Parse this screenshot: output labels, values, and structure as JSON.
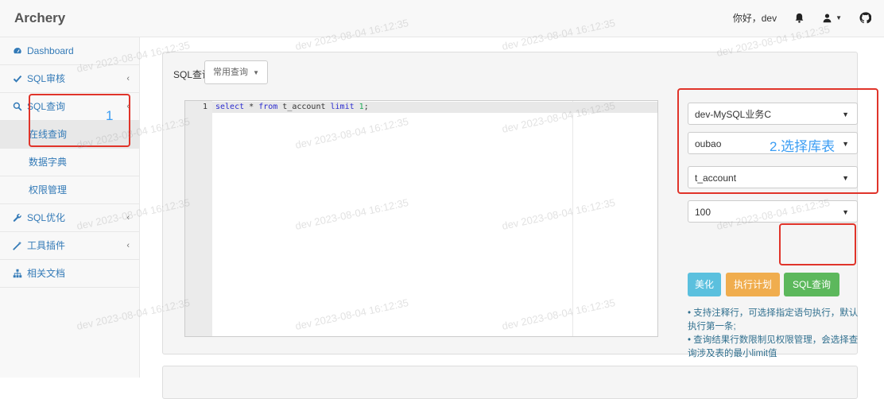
{
  "navbar": {
    "brand": "Archery",
    "greeting": "你好，dev"
  },
  "sidebar": {
    "items": [
      {
        "label": "Dashboard",
        "icon": "dashboard-icon"
      },
      {
        "label": "SQL审核",
        "icon": "check-icon"
      },
      {
        "label": "SQL查询",
        "icon": "search-icon"
      },
      {
        "label": "SQL优化",
        "icon": "wrench-icon"
      },
      {
        "label": "工具插件",
        "icon": "magic-icon"
      },
      {
        "label": "相关文档",
        "icon": "sitemap-icon"
      }
    ],
    "subitems": [
      "在线查询",
      "数据字典",
      "权限管理"
    ]
  },
  "panel": {
    "title": "SQL查询",
    "common_query_btn": "常用查询"
  },
  "editor": {
    "line_number": "1",
    "code_parts": [
      "select",
      " * ",
      "from",
      " t_account ",
      "limit",
      " ",
      "1",
      ";"
    ]
  },
  "controls": {
    "instance": "dev-MySQL业务C",
    "database": "oubao",
    "table": "t_account",
    "limit": "100",
    "btn_beautify": "美化",
    "btn_explain": "执行计划",
    "btn_query": "SQL查询"
  },
  "tips": {
    "line1": "• 支持注释行，可选择指定语句执行，默认执行第一条;",
    "line2": "• 查询结果行数限制见权限管理，会选择查询涉及表的最小limit值"
  },
  "annotations": {
    "step1": "1",
    "step2": "2.选择库表"
  },
  "watermark": "dev 2023-08-04 16:12:35",
  "colors": {
    "beautify": "#5bc0de",
    "explain": "#f0ad4e",
    "query": "#5cb85c",
    "highlight": "#e0342a",
    "annotation": "#3b9df3"
  }
}
